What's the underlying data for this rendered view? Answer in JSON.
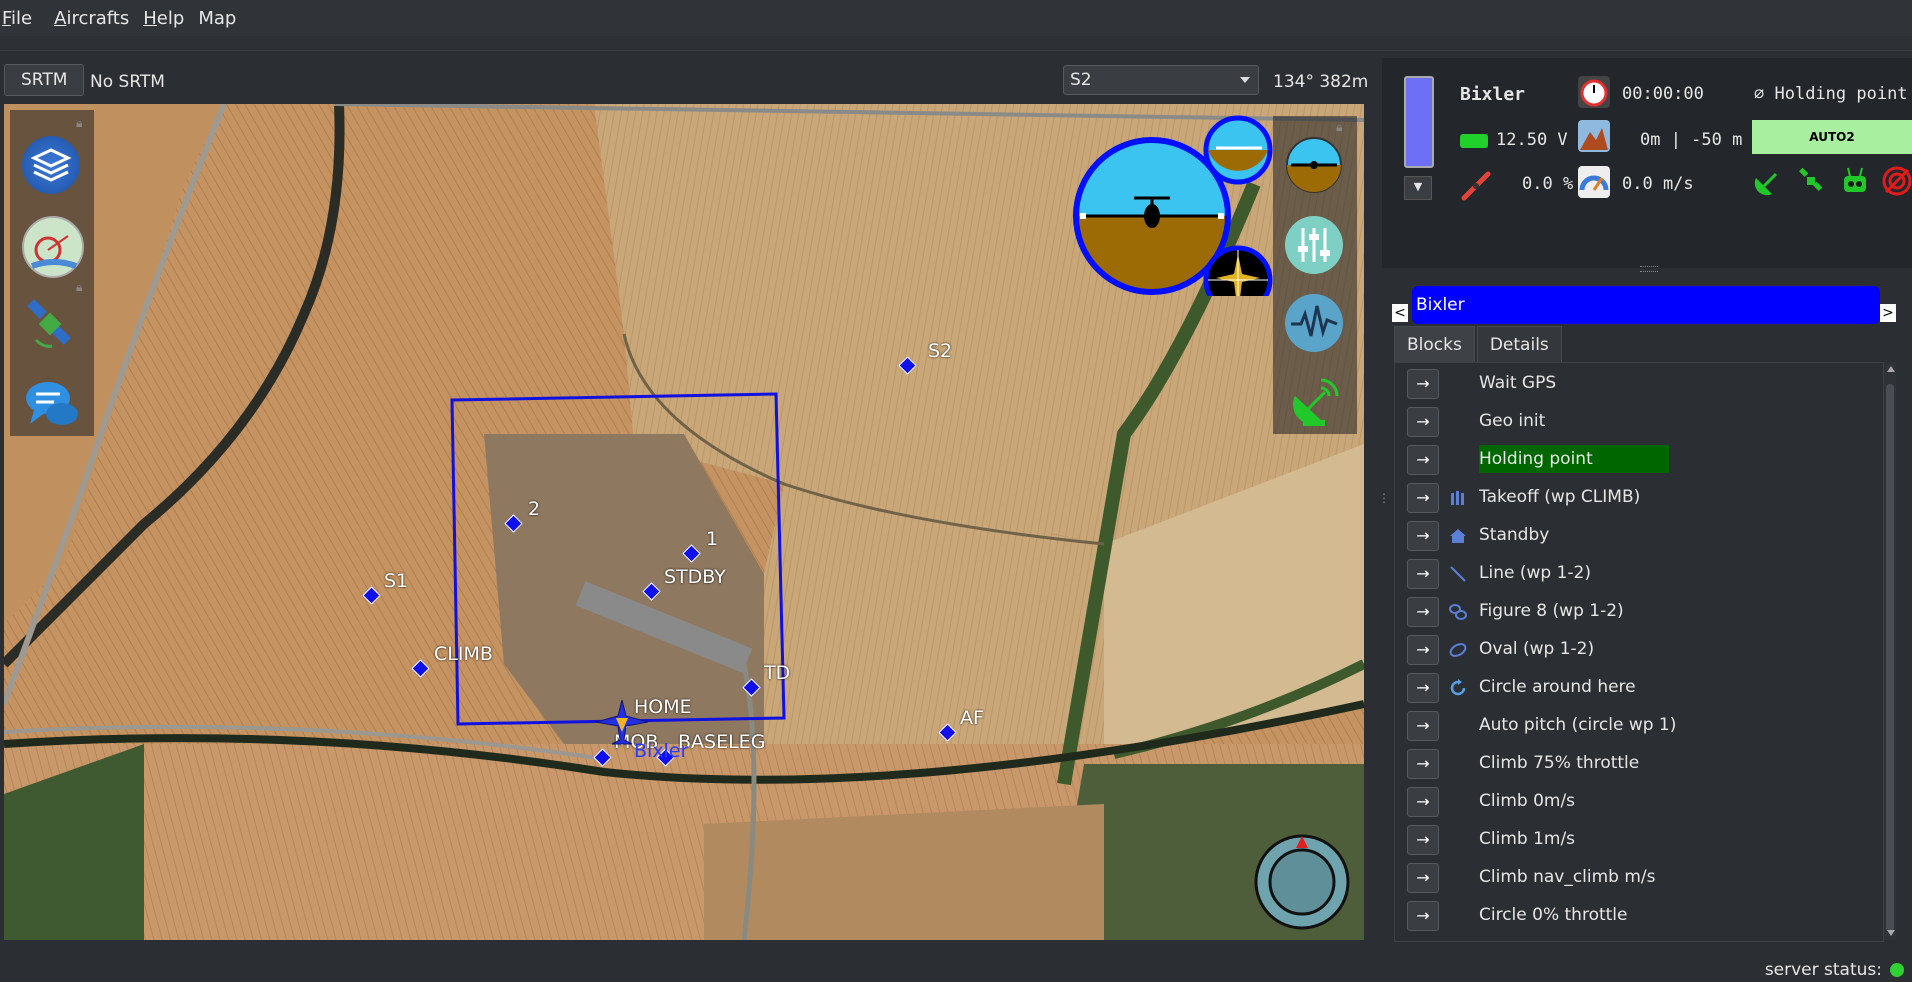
{
  "menu": [
    {
      "underline": "F",
      "rest": "ile"
    },
    {
      "underline": "A",
      "rest": "ircrafts"
    },
    {
      "underline": "H",
      "rest": "elp"
    },
    {
      "underline": "",
      "rest": "Map"
    }
  ],
  "topbar": {
    "srtm_button": "SRTM",
    "srtm_status": "No SRTM",
    "waypoint_select": "S2",
    "bearing": "134°  382m"
  },
  "map": {
    "waypoints": [
      {
        "label": "S2"
      },
      {
        "label": "2"
      },
      {
        "label": "1"
      },
      {
        "label": "STDBY"
      },
      {
        "label": "S1"
      },
      {
        "label": "CLIMB"
      },
      {
        "label": "TD"
      },
      {
        "label": "HOME"
      },
      {
        "label": "MOB"
      },
      {
        "label": "BASELEG"
      },
      {
        "label": "AF"
      }
    ],
    "aircraft_label": "Bixler",
    "tools": [
      "layers-icon",
      "flightplan-icon",
      "satellite-icon",
      "chat-icon"
    ],
    "instruments": [
      "attitude-small-icon",
      "sliders-icon",
      "waveform-icon",
      "antenna-icon"
    ]
  },
  "strip": {
    "name": "Bixler",
    "time": "00:00:00",
    "block": "Holding point",
    "voltage": "12.50 V",
    "altitude": "0m | -50 m",
    "mode": "AUTO2",
    "throttle": "0.0 %",
    "climb": "0.0 m/s",
    "accent": "#0000ff",
    "mode_color": "#a8f0a0"
  },
  "aircraft_tab": {
    "name": "Bixler",
    "prev": "<",
    "next": ">"
  },
  "tabs": [
    "Blocks",
    "Details"
  ],
  "blocks": [
    {
      "label": "Wait GPS",
      "icon": ""
    },
    {
      "label": "Geo init",
      "icon": ""
    },
    {
      "label": "Holding point",
      "icon": "",
      "active": true
    },
    {
      "label": "Takeoff (wp CLIMB)",
      "icon": "takeoff-icon"
    },
    {
      "label": "Standby",
      "icon": "home-icon"
    },
    {
      "label": "Line (wp 1-2)",
      "icon": "line-icon"
    },
    {
      "label": "Figure 8 (wp 1-2)",
      "icon": "figure8-icon"
    },
    {
      "label": "Oval (wp 1-2)",
      "icon": "oval-icon"
    },
    {
      "label": "Circle around here",
      "icon": "circle-icon"
    },
    {
      "label": "Auto pitch (circle wp 1)",
      "icon": ""
    },
    {
      "label": "Climb 75% throttle",
      "icon": ""
    },
    {
      "label": "Climb 0m/s",
      "icon": ""
    },
    {
      "label": "Climb 1m/s",
      "icon": ""
    },
    {
      "label": "Climb nav_climb m/s",
      "icon": ""
    },
    {
      "label": "Circle 0% throttle",
      "icon": ""
    }
  ],
  "block_button": "→",
  "status": {
    "label": "server status:",
    "color": "#32d132"
  }
}
